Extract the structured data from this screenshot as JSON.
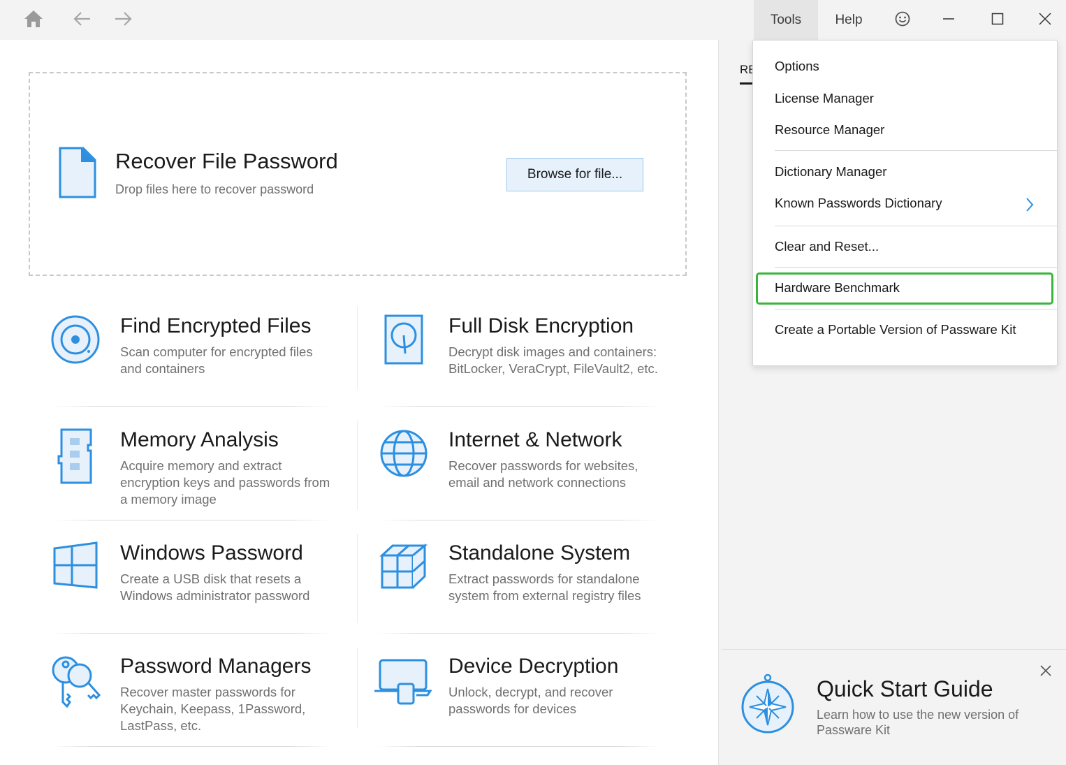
{
  "titlebar": {
    "menu_tools": "Tools",
    "menu_help": "Help",
    "icons": [
      "home-icon",
      "back-arrow-icon",
      "forward-arrow-icon",
      "smiley-icon",
      "minimize-icon",
      "maximize-icon",
      "close-icon"
    ]
  },
  "dropzone": {
    "title": "Recover File Password",
    "subtitle": "Drop files here to recover password",
    "browse_label": "Browse for file..."
  },
  "tiles": [
    {
      "title": "Find Encrypted Files",
      "desc": "Scan computer for encrypted files and containers",
      "icon": "disc-search-icon"
    },
    {
      "title": "Full Disk Encryption",
      "desc": "Decrypt disk images and containers: BitLocker, VeraCrypt, FileVault2, etc.",
      "icon": "hard-disk-icon"
    },
    {
      "title": "Memory Analysis",
      "desc": "Acquire memory and extract encryption keys and passwords from a memory image",
      "icon": "memory-module-icon"
    },
    {
      "title": "Internet & Network",
      "desc": "Recover passwords for websites, email and network connections",
      "icon": "globe-icon"
    },
    {
      "title": "Windows Password",
      "desc": "Create a USB disk that resets a Windows administrator password",
      "icon": "windows-logo-icon"
    },
    {
      "title": "Standalone System",
      "desc": "Extract passwords for standalone system from external registry files",
      "icon": "cubes-icon"
    },
    {
      "title": "Password Managers",
      "desc": "Recover master passwords for Keychain, Keepass, 1Password, LastPass, etc.",
      "icon": "keys-icon"
    },
    {
      "title": "Device Decryption",
      "desc": "Unlock, decrypt, and recover passwords for devices",
      "icon": "laptop-icon"
    }
  ],
  "right_panel": {
    "tab_partial": "RE",
    "quick_start": {
      "title": "Quick Start Guide",
      "subtitle": "Learn how to use the new version of Passware Kit",
      "icon": "compass-icon"
    }
  },
  "tools_menu": {
    "items": [
      "Options",
      "License Manager",
      "Resource Manager",
      "Dictionary Manager",
      "Known Passwords Dictionary",
      "Clear and Reset...",
      "Hardware Benchmark",
      "Create a Portable Version of Passware Kit"
    ],
    "highlighted_item": "Hardware Benchmark",
    "highlight_color": "#3ab53a"
  },
  "colors": {
    "accent": "#2d8fe0",
    "icon_fill": "#e6f1fb"
  }
}
